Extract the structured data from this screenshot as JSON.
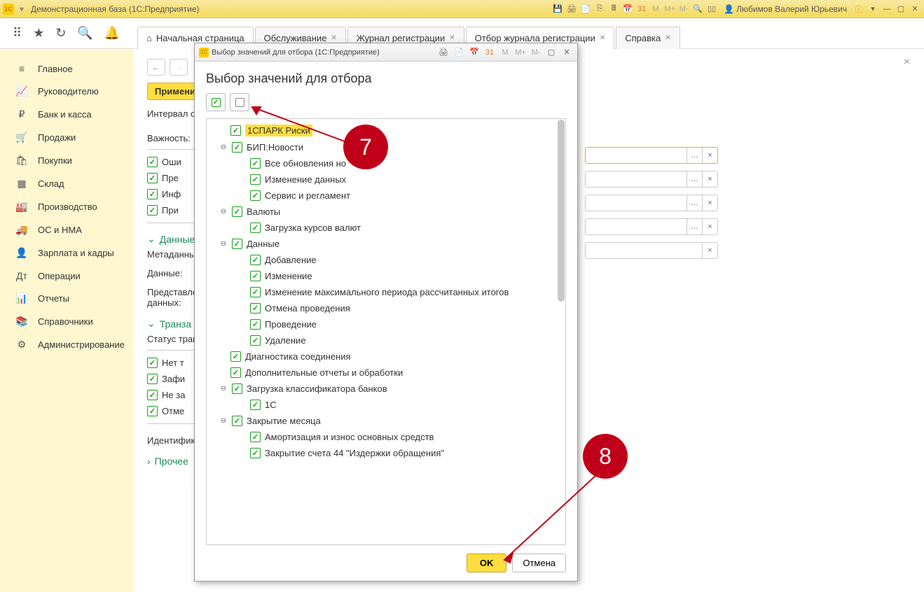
{
  "titlebar": {
    "logo": "1C",
    "title": "Демонстрационная база  (1С:Предприятие)",
    "user": "Любимов Валерий Юрьевич",
    "m_labels": [
      "M",
      "M+",
      "M-"
    ]
  },
  "tabs": [
    {
      "label": "Начальная страница",
      "home": true
    },
    {
      "label": "Обслуживание",
      "close": true
    },
    {
      "label": "Журнал регистрации",
      "close": true
    },
    {
      "label": "Отбор журнала регистрации",
      "close": true,
      "active": true
    },
    {
      "label": "Справка",
      "close": true
    }
  ],
  "sidebar": [
    {
      "icon": "≡",
      "label": "Главное"
    },
    {
      "icon": "📈",
      "label": "Руководителю"
    },
    {
      "icon": "₽",
      "label": "Банк и касса"
    },
    {
      "icon": "🛒",
      "label": "Продажи"
    },
    {
      "icon": "🛍",
      "label": "Покупки"
    },
    {
      "icon": "▦",
      "label": "Склад"
    },
    {
      "icon": "🏭",
      "label": "Производство"
    },
    {
      "icon": "🚚",
      "label": "ОС и НМА"
    },
    {
      "icon": "👤",
      "label": "Зарплата и кадры"
    },
    {
      "icon": "Дт",
      "label": "Операции"
    },
    {
      "icon": "📊",
      "label": "Отчеты"
    },
    {
      "icon": "📚",
      "label": "Справочники"
    },
    {
      "icon": "⚙",
      "label": "Администрирование"
    }
  ],
  "content": {
    "apply": "Примени",
    "interval": "Интервал с:",
    "importance": "Важность:",
    "chk_err": "Оши",
    "chk_warn": "Пре",
    "chk_info": "Инф",
    "chk_note": "При",
    "section_data": "Данные",
    "lbl_meta": "Метаданны",
    "lbl_data": "Данные:",
    "lbl_repr1": "Представле",
    "lbl_repr2": "данных:",
    "section_trans": "Транза",
    "lbl_status": "Статус тран",
    "chk_t1": "Нет т",
    "chk_t2": "Зафи",
    "chk_t3": "Не за",
    "chk_t4": "Отме",
    "lbl_ident": "Идентифика",
    "section_other": "Прочее"
  },
  "dialog": {
    "window_title": "Выбор значений для отбора  (1С:Предприятие)",
    "title": "Выбор значений для отбора",
    "m_labels": [
      "M",
      "M+",
      "M-"
    ],
    "tree": [
      {
        "level": 0,
        "expand": "",
        "label": "1СПАРК Риски",
        "highlight": true
      },
      {
        "level": 1,
        "expand": "⊖",
        "label": "БИП:Новости"
      },
      {
        "level": 2,
        "expand": "",
        "label": "Все обновления но"
      },
      {
        "level": 2,
        "expand": "",
        "label": "Изменение данных"
      },
      {
        "level": 2,
        "expand": "",
        "label": "Сервис и регламент"
      },
      {
        "level": 1,
        "expand": "⊖",
        "label": "Валюты"
      },
      {
        "level": 2,
        "expand": "",
        "label": "Загрузка курсов валют"
      },
      {
        "level": 1,
        "expand": "⊖",
        "label": "Данные"
      },
      {
        "level": 2,
        "expand": "",
        "label": "Добавление"
      },
      {
        "level": 2,
        "expand": "",
        "label": "Изменение"
      },
      {
        "level": 2,
        "expand": "",
        "label": "Изменение максимального периода рассчитанных итогов"
      },
      {
        "level": 2,
        "expand": "",
        "label": "Отмена проведения"
      },
      {
        "level": 2,
        "expand": "",
        "label": "Проведение"
      },
      {
        "level": 2,
        "expand": "",
        "label": "Удаление"
      },
      {
        "level": 0,
        "expand": "",
        "label": "Диагностика соединения"
      },
      {
        "level": 0,
        "expand": "",
        "label": "Дополнительные отчеты и обработки"
      },
      {
        "level": 1,
        "expand": "⊖",
        "label": "Загрузка классификатора банков"
      },
      {
        "level": 2,
        "expand": "",
        "label": "1С"
      },
      {
        "level": 1,
        "expand": "⊖",
        "label": "Закрытие месяца"
      },
      {
        "level": 2,
        "expand": "",
        "label": "Амортизация и износ основных средств"
      },
      {
        "level": 2,
        "expand": "",
        "label": "Закрытие счета 44 \"Издержки обращения\""
      }
    ],
    "ok": "OK",
    "cancel": "Отмена"
  },
  "markers": {
    "m7": "7",
    "m8": "8"
  }
}
